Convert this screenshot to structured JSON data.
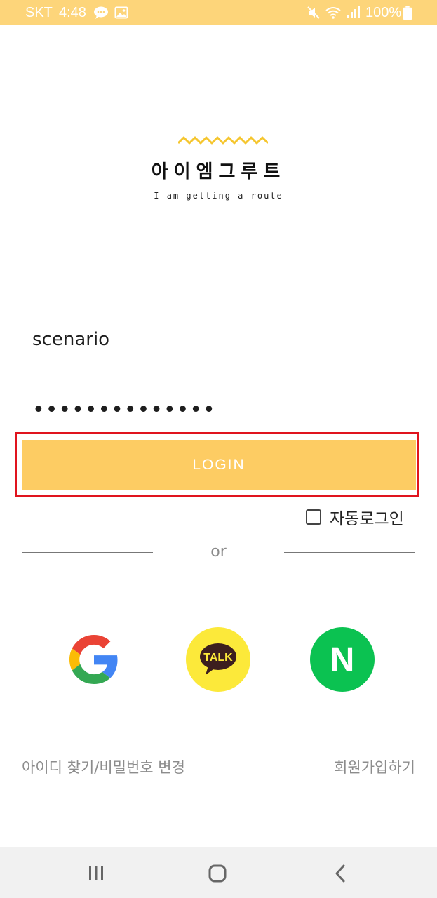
{
  "status_bar": {
    "carrier": "SKT",
    "time": "4:48",
    "battery": "100%"
  },
  "logo": {
    "title": "아이엠그루트",
    "subtitle": "I am getting a route"
  },
  "login_form": {
    "username_value": "scenario",
    "password_value": "••••••••••••••",
    "login_label": "LOGIN",
    "auto_login_label": "자동로그인",
    "auto_login_checked": false,
    "divider_text": "or"
  },
  "social": {
    "google_icon": "google-icon",
    "kakao_label": "TALK",
    "naver_label": "N"
  },
  "links": {
    "find_account": "아이디 찾기/비밀번호 변경",
    "signup": "회원가입하기"
  },
  "colors": {
    "status_bar": "#fdd57a",
    "login_button": "#fdcc63",
    "kakao": "#fce93a",
    "naver": "#0bc251",
    "highlight": "#e0141e"
  }
}
